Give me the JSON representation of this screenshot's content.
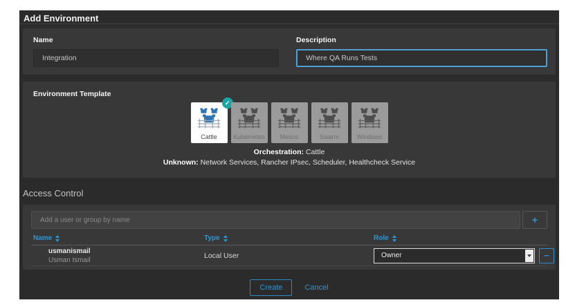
{
  "page": {
    "title": "Add Environment"
  },
  "form": {
    "name_label": "Name",
    "name_value": "Integration",
    "description_label": "Description",
    "description_value": "Where QA Runs Tests"
  },
  "templates": {
    "label": "Environment Template",
    "items": [
      {
        "label": "Cattle",
        "selected": true
      },
      {
        "label": "Kubernetes",
        "selected": false
      },
      {
        "label": "Mesos",
        "selected": false
      },
      {
        "label": "Swarm",
        "selected": false
      },
      {
        "label": "Windows",
        "selected": false
      }
    ],
    "orchestration_label": "Orchestration",
    "orchestration_value": "Cattle",
    "unknown_label": "Unknown",
    "unknown_value": "Network Services, Rancher IPsec, Scheduler, Healthcheck Service"
  },
  "access_control": {
    "title": "Access Control",
    "add_placeholder": "Add a user or group by name",
    "add_button": "+",
    "columns": [
      "Name",
      "Type",
      "Role"
    ],
    "rows": [
      {
        "username": "usmanismail",
        "full_name": "Usman Ismail",
        "type": "Local User",
        "role": "Owner"
      }
    ],
    "remove_button": "−"
  },
  "footer": {
    "create_label": "Create",
    "cancel_label": "Cancel"
  },
  "colors": {
    "accent_blue": "#2f96d2",
    "focus_border": "#4f9fd9",
    "check_teal": "#1ba5a5",
    "cattle_blue": "#2e74b2",
    "panel_bg": "#383838",
    "page_bg": "#2b2b2b"
  }
}
